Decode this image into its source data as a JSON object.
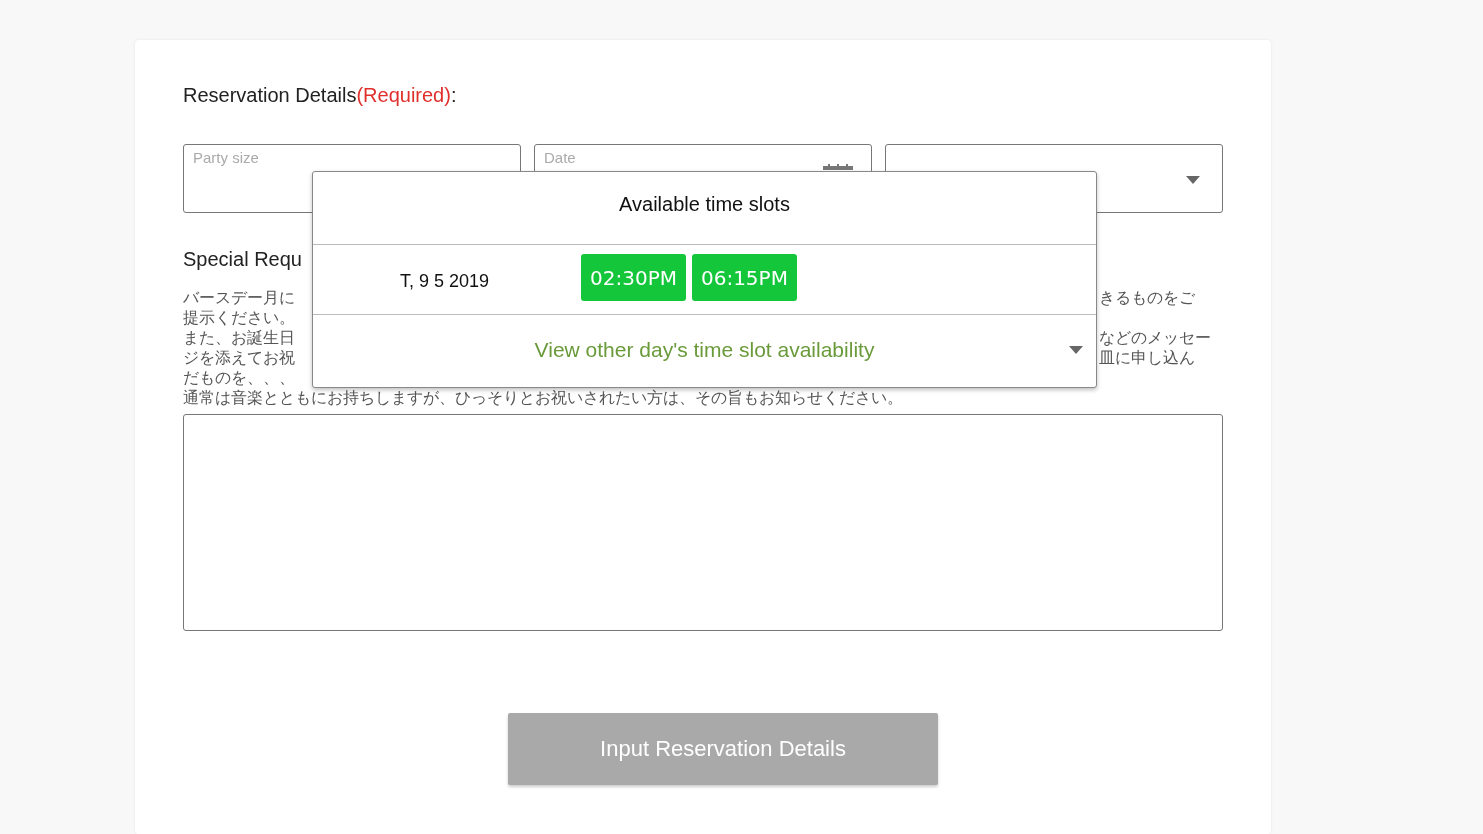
{
  "heading": {
    "label": "Reservation Details",
    "required": "(Required)",
    "colon": ":"
  },
  "fields": [
    {
      "kind": "select",
      "label": "Party size"
    },
    {
      "kind": "date",
      "label": "Date"
    },
    {
      "kind": "select"
    }
  ],
  "special": {
    "title": "Special Requ",
    "note_lines": [
      {
        "left": "バースデー月に",
        "right": "きるものをご"
      },
      {
        "left": "提示ください。"
      },
      {
        "left": "また、お誕生日",
        "right": "などのメッセー"
      },
      {
        "left": "ジを添えてお祝",
        "right": "皿に申し込ん"
      },
      {
        "left": "だものを、、、"
      },
      {
        "left": "通常は音楽とともにお持ちしますが、ひっそりとお祝いされたい方は、その旨もお知らせください。"
      }
    ]
  },
  "submit": {
    "label": "Input Reservation Details",
    "disabled": true
  },
  "popup": {
    "title": "Available time slots",
    "date": "T, 9 5 2019",
    "slots": [
      "02:30PM",
      "06:15PM"
    ],
    "other_days": "View other day's time slot availability"
  }
}
